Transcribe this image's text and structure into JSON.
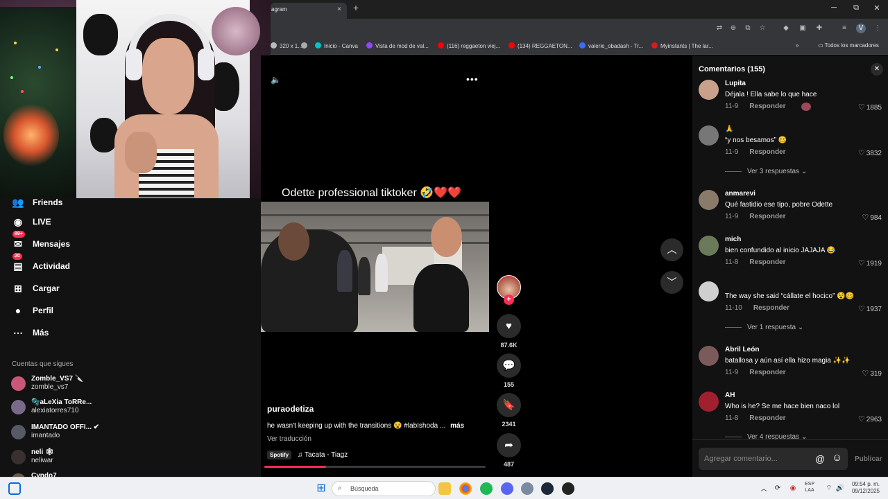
{
  "browser": {
    "tab_title": "agram",
    "tab_close": "×",
    "new_tab": "+",
    "window_controls": {
      "minimize": "─",
      "maximize": "⧉",
      "close": "✕"
    },
    "bookmarks": [
      {
        "label": "320 x 1...",
        "color": "#bbbbbb"
      },
      {
        "label": "",
        "color": "#aaaaaa"
      },
      {
        "label": "Inicio - Canva",
        "color": "#00c4cc"
      },
      {
        "label": "Vista de mod de val...",
        "color": "#9146ff"
      },
      {
        "label": "(116) reggaeton viej...",
        "color": "#ff0000"
      },
      {
        "label": "(134) REGGAETON...",
        "color": "#ff0000"
      },
      {
        "label": "valerie_obadash - Tr...",
        "color": "#3b6cf6"
      },
      {
        "label": "Myinstants | The lar...",
        "color": "#d61c1c"
      }
    ],
    "bookmarks_overflow": "»",
    "all_bookmarks": "Todos los marcadores"
  },
  "sidebar": {
    "items": [
      {
        "label": "Friends",
        "icon": "friends-icon"
      },
      {
        "label": "LIVE",
        "icon": "live-icon"
      },
      {
        "label": "Mensajes",
        "icon": "messages-icon",
        "badge": "99+"
      },
      {
        "label": "Actividad",
        "icon": "activity-icon",
        "badge": "20"
      },
      {
        "label": "Cargar",
        "icon": "upload-icon"
      },
      {
        "label": "Perfil",
        "icon": "profile-icon"
      },
      {
        "label": "Más",
        "icon": "more-icon"
      }
    ],
    "following_title": "Cuentas que sigues",
    "following": [
      {
        "name": "Zomble_VS7 🔪",
        "user": "zomble_vs7",
        "color": "#c8577a"
      },
      {
        "name": "🫧aLeXia ToRRe...",
        "user": "alexiatorres710",
        "color": "#7a6a8a"
      },
      {
        "name": "IMANTADO OFFI... ✔",
        "user": "imantado",
        "color": "#555a66"
      },
      {
        "name": "neli 🕸",
        "user": "neliwar",
        "color": "#3a3030"
      },
      {
        "name": "Cyndo7",
        "user": "",
        "color": "#6a5a4a"
      }
    ]
  },
  "video": {
    "caption_overlay": "Odette professional tiktoker 🤣❤️❤️",
    "author": "puraodetiza",
    "description": "he wasn't keeping up with the transitions 😵 #labIshoda ...",
    "more": "más",
    "translate": "Ver traducción",
    "music_source": "Spotify",
    "music_track": "♫  Tacata - Tiagz",
    "progress": 0.28
  },
  "actions": {
    "likes": "87.6K",
    "comments": "155",
    "saves": "2341",
    "shares": "487"
  },
  "comments": {
    "title": "Comentarios (155)",
    "reply_label": "Responder",
    "placeholder": "Agregar comentario...",
    "post_label": "Publicar",
    "items": [
      {
        "user": "Lupita",
        "text": "Déjala ! Ella sabe lo que hace",
        "date": "11-9",
        "likes": "1885",
        "color": "#c9a08a"
      },
      {
        "user": "🙏",
        "text": "“y nos besamos” 🥴",
        "date": "11-9",
        "likes": "3832",
        "color": "#777777",
        "replies": "Ver 3 respuestas"
      },
      {
        "user": "anmarevi",
        "text": "Qué fastidio ese tipo, pobre Odette",
        "date": "11-9",
        "likes": "984",
        "color": "#8a7a6a"
      },
      {
        "user": "mich",
        "text": "bien confundido al inicio JAJAJA 😂",
        "date": "11-8",
        "likes": "1919",
        "color": "#6a7a5a"
      },
      {
        "user": "",
        "text": "The way she said “cállate el hocico” 😵🥴",
        "date": "11-10",
        "likes": "1937",
        "color": "#cfcfcf",
        "replies": "Ver 1 respuesta"
      },
      {
        "user": "Abril León",
        "text": "batallosa y aún así ella hizo magia ✨✨",
        "date": "11-9",
        "likes": "319",
        "color": "#7a5a5a"
      },
      {
        "user": "AH",
        "text": "Who is he? Se me hace bien naco lol",
        "date": "11-8",
        "likes": "2963",
        "color": "#a02030",
        "replies": "Ver 4 respuestas"
      }
    ]
  },
  "taskbar": {
    "search": "Búsqueda",
    "lang_top": "ESP",
    "lang_bottom": "LAA",
    "time": "09:54 p. m.",
    "date": "09/12/2025"
  }
}
